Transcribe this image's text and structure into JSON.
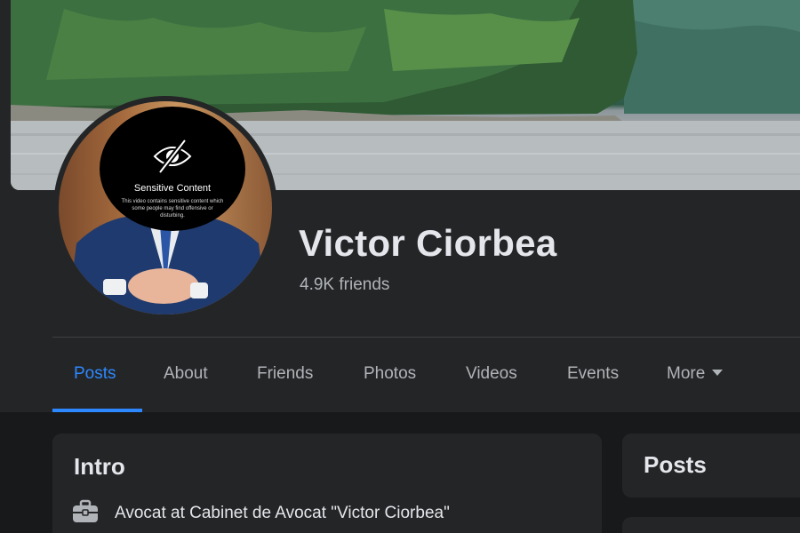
{
  "profile": {
    "name": "Victor Ciorbea",
    "friends": "4.9K friends",
    "sensitive_title": "Sensitive Content",
    "sensitive_desc": "This video contains sensitive content which some people may find offensive or disturbing."
  },
  "tabs": [
    {
      "label": "Posts",
      "active": true
    },
    {
      "label": "About"
    },
    {
      "label": "Friends"
    },
    {
      "label": "Photos"
    },
    {
      "label": "Videos"
    },
    {
      "label": "Events"
    },
    {
      "label": "More"
    }
  ],
  "intro": {
    "title": "Intro",
    "work": "Avocat at Cabinet de Avocat \"Victor Ciorbea\""
  },
  "posts": {
    "title": "Posts"
  },
  "colors": {
    "accent": "#2d88ff",
    "background": "#18191a",
    "card": "#242526"
  },
  "icons": [
    "eye-slash-icon",
    "briefcase-icon",
    "caret-down-icon"
  ]
}
